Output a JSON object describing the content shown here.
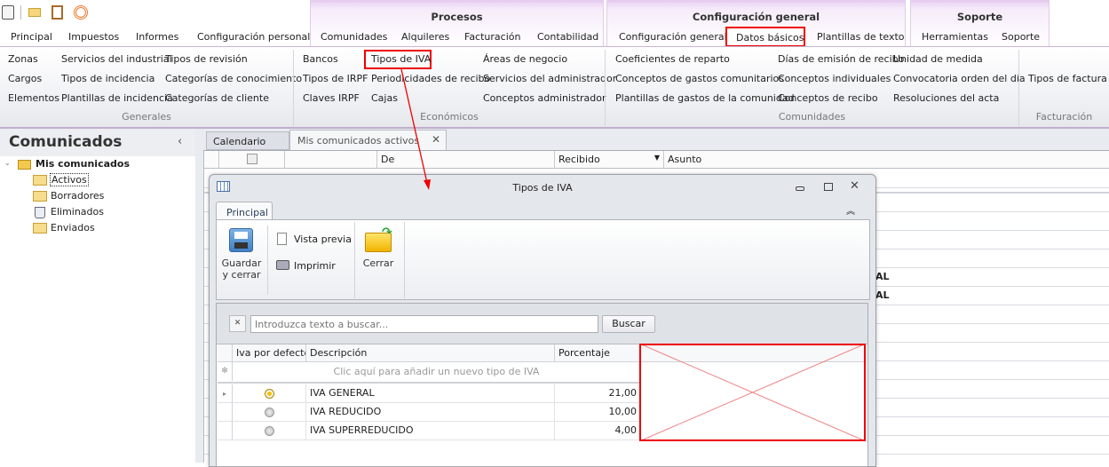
{
  "quick_access": [
    "app-icon",
    "mail-icon",
    "clipboard-icon",
    "broadcast-icon"
  ],
  "context_groups": [
    {
      "title": "Procesos"
    },
    {
      "title": "Configuración general"
    },
    {
      "title": "Soporte"
    }
  ],
  "tabs": [
    "Principal",
    "Impuestos",
    "Informes",
    "Configuración personal",
    "Comunidades",
    "Alquileres",
    "Facturación",
    "Contabilidad",
    "Configuración general",
    "Datos básicos",
    "Plantillas de texto",
    "Herramientas",
    "Soporte"
  ],
  "active_tab": "Datos básicos",
  "ribbon": {
    "generales": {
      "label": "Generales",
      "col1": [
        "Zonas",
        "Cargos",
        "Elementos"
      ],
      "col2": [
        "Servicios del industrial",
        "Tipos de incidencia",
        "Plantillas de incidencia"
      ],
      "col3": [
        "Tipos de revisión",
        "Categorías de conocimiento",
        "Categorías de cliente"
      ]
    },
    "economicos": {
      "label": "Económicos",
      "col1": [
        "Bancos",
        "Tipos de IRPF",
        "Claves IRPF"
      ],
      "col2": [
        "Tipos de IVA",
        "Periodicidades de recibo",
        "Cajas"
      ],
      "col3": [
        "Áreas de negocio",
        "Servicios del administrador",
        "Conceptos administrador"
      ]
    },
    "comunidades": {
      "label": "Comunidades",
      "col1": [
        "Coeficientes de reparto",
        "Conceptos de gastos comunitarios",
        "Plantillas de gastos de la comunidad"
      ],
      "col2": [
        "Días de emisión de recibo",
        "Conceptos individuales",
        "Conceptos de recibo"
      ],
      "col3": [
        "Unidad de medida",
        "Convocatoria orden del día",
        "Resoluciones del acta"
      ]
    },
    "facturacion": {
      "label": "Facturación",
      "items": [
        "Tipos de factura"
      ]
    }
  },
  "left_panel": {
    "title": "Comunicados",
    "root": "Mis comunicados",
    "items": [
      "Activos",
      "Borradores",
      "Eliminados",
      "Enviados"
    ]
  },
  "doc_tabs": [
    "Calendario",
    "Mis comunicados activos"
  ],
  "main_grid": {
    "columns": [
      "De",
      "Recibido",
      "Asunto"
    ],
    "partial_cells": [
      "AL",
      "AL"
    ]
  },
  "dialog": {
    "title": "Tipos de IVA",
    "tab": "Principal",
    "buttons": {
      "save": "Guardar\ny cerrar",
      "preview": "Vista previa",
      "print": "Imprimir",
      "close": "Cerrar"
    },
    "search": {
      "placeholder": "Introduzca texto a buscar...",
      "value": "",
      "button": "Buscar"
    },
    "grid": {
      "columns": [
        "Iva por defecto",
        "Descripción",
        "Porcentaje"
      ],
      "new_row": "Clic aquí para añadir un nuevo tipo de IVA",
      "rows": [
        {
          "default": true,
          "description": "IVA GENERAL",
          "percent": "21,00"
        },
        {
          "default": false,
          "description": "IVA REDUCIDO",
          "percent": "10,00"
        },
        {
          "default": false,
          "description": "IVA SUPERREDUCIDO",
          "percent": "4,00"
        }
      ]
    }
  },
  "colors": {
    "annotation": "#e00000",
    "context_tab": "#ecd8f4"
  }
}
